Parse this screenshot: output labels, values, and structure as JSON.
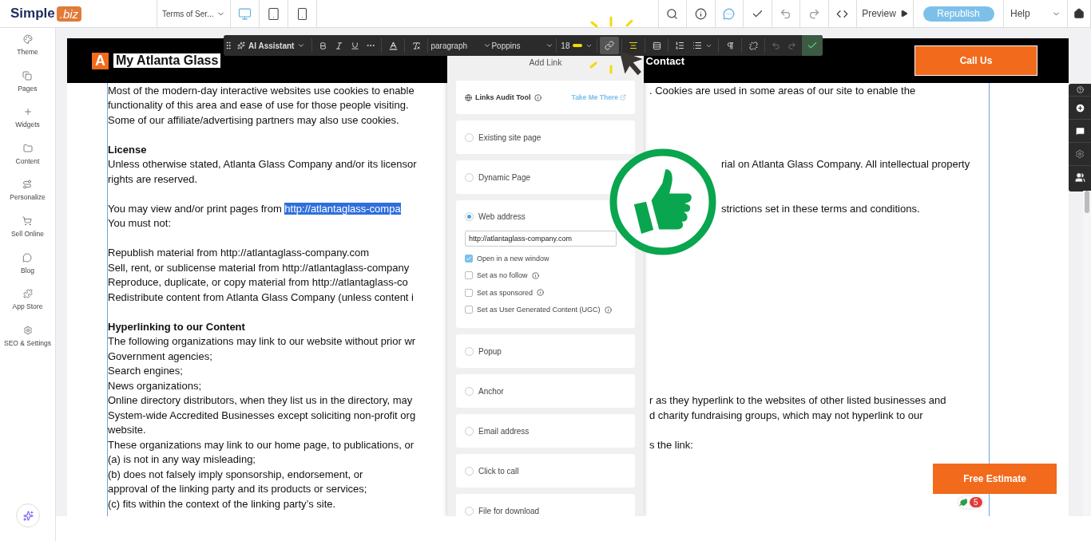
{
  "top_bar": {
    "logo": {
      "word": "Simple",
      "badge": ".biz"
    },
    "page_select": "Terms of Ser...",
    "devices": [
      {
        "kind": "desktop",
        "selected": true
      },
      {
        "kind": "tablet",
        "selected": false
      },
      {
        "kind": "phone",
        "selected": false
      }
    ],
    "tools": [
      {
        "kind": "search"
      },
      {
        "kind": "info"
      },
      {
        "kind": "comments"
      },
      {
        "kind": "check"
      },
      {
        "kind": "undo"
      },
      {
        "kind": "redo"
      },
      {
        "kind": "code"
      }
    ],
    "preview": "Preview",
    "publish": "Republish",
    "help": "Help"
  },
  "sidebar": {
    "items": [
      {
        "kind": "theme",
        "label": "Theme"
      },
      {
        "kind": "pages",
        "label": "Pages"
      },
      {
        "kind": "widgets",
        "label": "Widgets"
      },
      {
        "kind": "content",
        "label": "Content"
      },
      {
        "kind": "personalize",
        "label": "Personalize"
      },
      {
        "kind": "sell",
        "label": "Sell Online"
      },
      {
        "kind": "blog",
        "label": "Blog"
      },
      {
        "kind": "apps",
        "label": "App Store"
      },
      {
        "kind": "seo",
        "label": "SEO & Settings"
      }
    ]
  },
  "format_toolbar": {
    "ai": "AI Assistant",
    "style": "paragraph",
    "font": "Poppins",
    "size": "18",
    "link_active": true
  },
  "site_header": {
    "logo_letter": "A",
    "title": "My Atlanta Glass",
    "nav": [
      "Contact"
    ],
    "cta": "Call Us"
  },
  "document": {
    "lines": [
      {
        "kind": "text",
        "left": "Most of the modern-day interactive websites use cookies to enable",
        "right": ". Cookies are used in some areas of our site to enable the"
      },
      {
        "kind": "text",
        "left": "functionality of this area and ease of use for those people visiting."
      },
      {
        "kind": "text",
        "left": "Some of our affiliate/advertising partners may also use cookies."
      },
      {
        "kind": "blank"
      },
      {
        "kind": "heading",
        "left": "License"
      },
      {
        "kind": "text",
        "left": "Unless otherwise stated, Atlanta Glass Company and/or its licensor",
        "right": "rial on Atlanta Glass Company. All intellectual property"
      },
      {
        "kind": "text",
        "left": "rights are reserved."
      },
      {
        "kind": "blank"
      },
      {
        "kind": "text",
        "left": "You may view and/or print pages from ",
        "selection": "http://atlantaglass-compa",
        "right": "strictions set in these terms and conditions."
      },
      {
        "kind": "text",
        "left": "You must not:"
      },
      {
        "kind": "blank"
      },
      {
        "kind": "text",
        "left": "Republish material from http://atlantaglass-company.com"
      },
      {
        "kind": "text",
        "left": "Sell, rent, or sublicense material from http://atlantaglass-company"
      },
      {
        "kind": "text",
        "left": "Reproduce, duplicate, or copy material from http://atlantaglass-co"
      },
      {
        "kind": "text",
        "left": "Redistribute content from Atlanta Glass Company (unless content i"
      },
      {
        "kind": "blank"
      },
      {
        "kind": "heading",
        "left": "Hyperlinking to our Content"
      },
      {
        "kind": "text",
        "left": "The following organizations may link to our website without prior wr"
      },
      {
        "kind": "text",
        "left": "Government agencies;"
      },
      {
        "kind": "text",
        "left": "Search engines;"
      },
      {
        "kind": "text",
        "left": "News organizations;"
      },
      {
        "kind": "text",
        "left": "Online directory distributors, when they list us in the directory, may",
        "right": "r as they hyperlink to the websites of other listed businesses and"
      },
      {
        "kind": "text",
        "left": "System-wide Accredited Businesses except soliciting non-profit org",
        "right": "d charity fundraising groups, which may not hyperlink to our"
      },
      {
        "kind": "text",
        "left": "website."
      },
      {
        "kind": "text",
        "left": "These organizations may link to our home page, to publications, or",
        "right": "s the link:"
      },
      {
        "kind": "text",
        "left": "(a) is not in any way misleading;"
      },
      {
        "kind": "text",
        "left": "(b) does not falsely imply sponsorship, endorsement, or"
      },
      {
        "kind": "text",
        "left": "approval of the linking party and its products or services;"
      },
      {
        "kind": "text",
        "left": "(c) fits within the context of the linking party’s site."
      }
    ]
  },
  "link_panel": {
    "title": "Add Link",
    "audit": {
      "label": "Links Audit Tool",
      "action": "Take Me There"
    },
    "options": [
      {
        "label": "Existing site page",
        "selected": false
      },
      {
        "label": "Dynamic Page",
        "selected": false
      },
      {
        "label": "Web address",
        "selected": true,
        "url": "http://atlantaglass-company.com",
        "settings": [
          {
            "label": "Open in a new window",
            "checked": true,
            "info": false
          },
          {
            "label": "Set as no follow",
            "checked": false,
            "info": true
          },
          {
            "label": "Set as sponsored",
            "checked": false,
            "info": true
          },
          {
            "label": "Set as User Generated Content (UGC)",
            "checked": false,
            "info": true
          }
        ]
      },
      {
        "label": "Popup",
        "selected": false
      },
      {
        "label": "Anchor",
        "selected": false
      },
      {
        "label": "Email address",
        "selected": false
      },
      {
        "label": "Click to call",
        "selected": false
      },
      {
        "label": "File for download",
        "selected": false
      }
    ]
  },
  "free_estimate": "Free Estimate",
  "notification_count": "5"
}
